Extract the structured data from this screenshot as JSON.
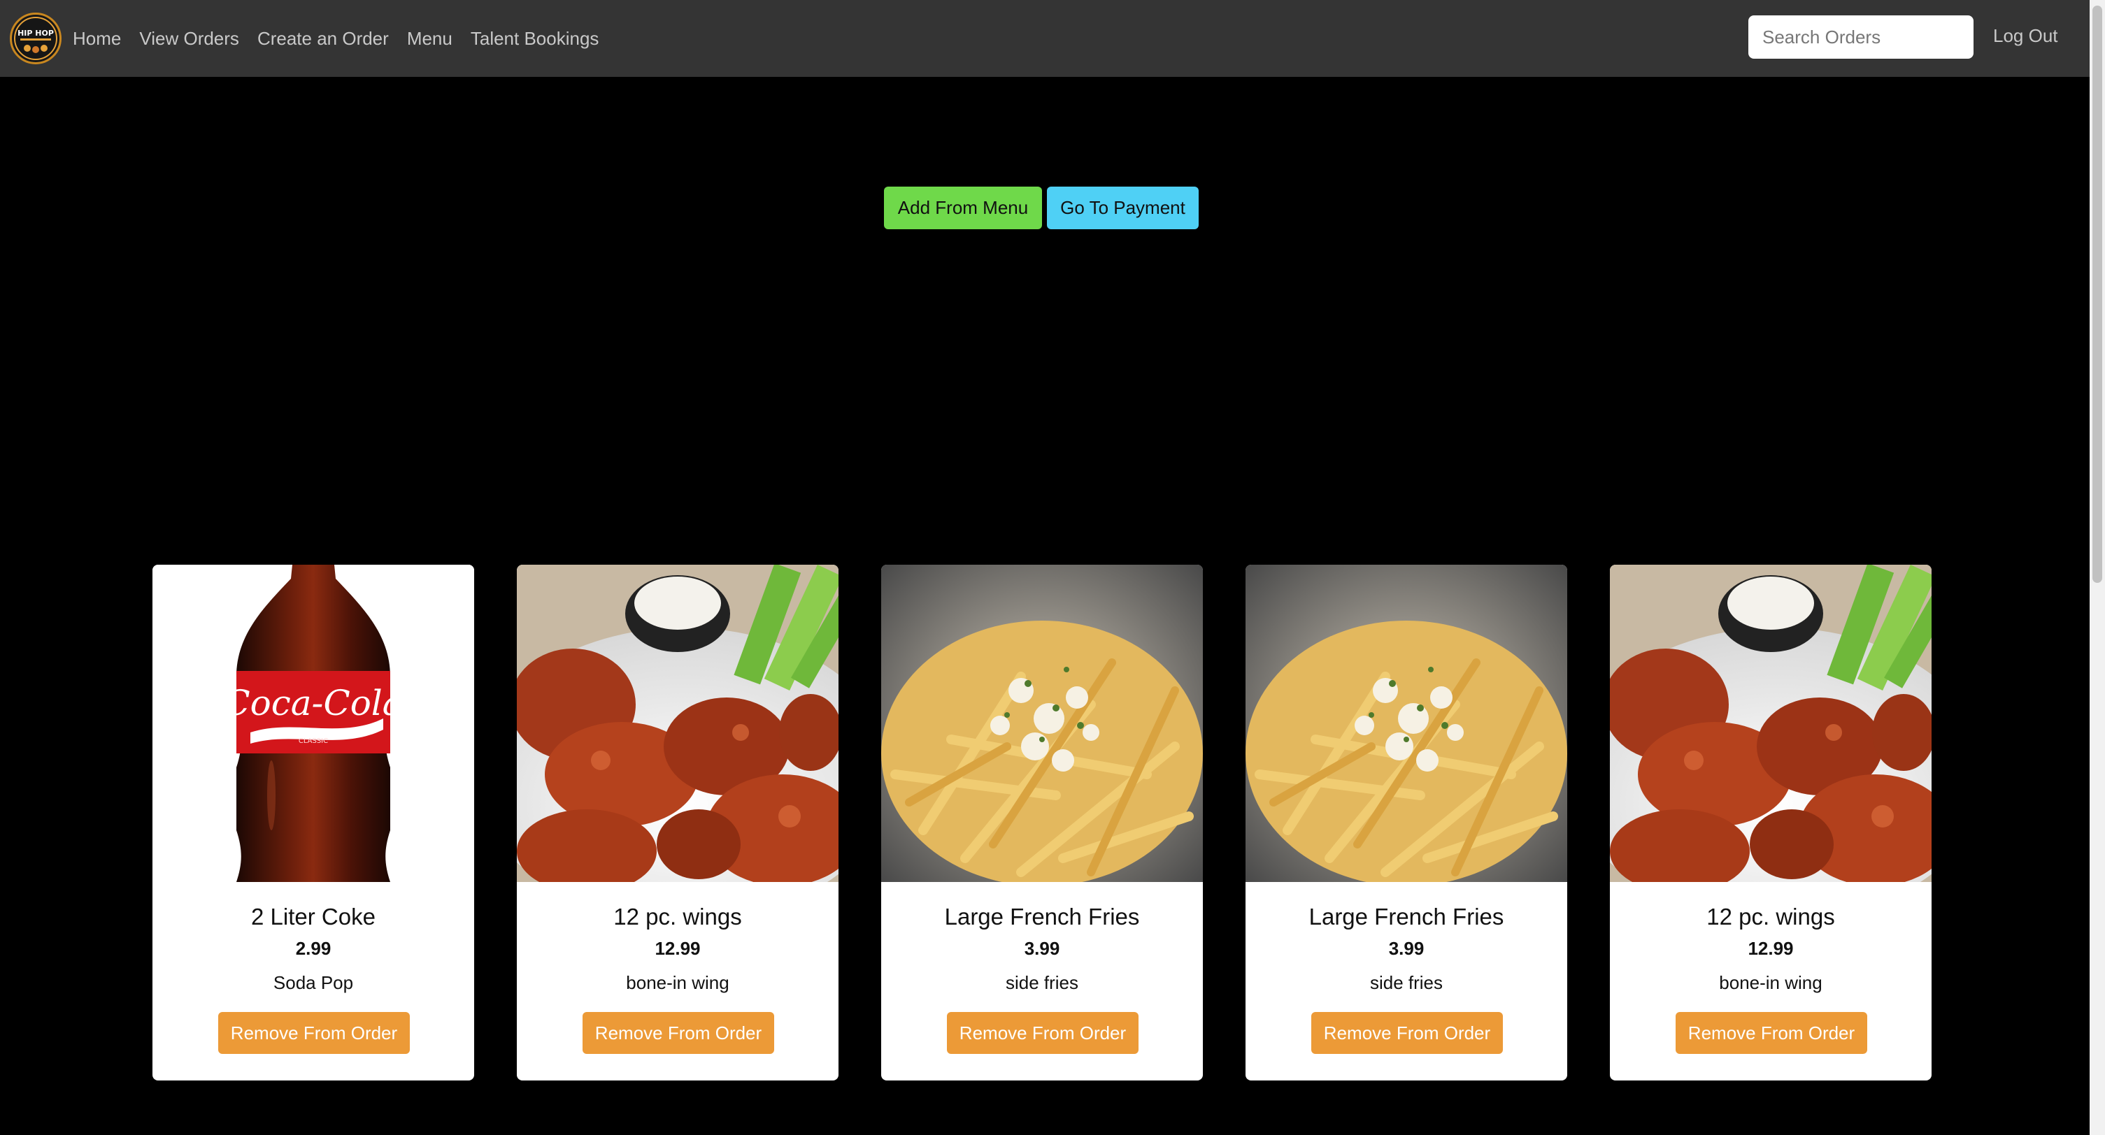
{
  "nav": {
    "logo_text": "HIP HOP",
    "links": [
      "Home",
      "View Orders",
      "Create an Order",
      "Menu",
      "Talent Bookings"
    ],
    "search_placeholder": "Search Orders",
    "logout_label": "Log Out"
  },
  "actions": {
    "add_label": "Add From Menu",
    "payment_label": "Go To Payment"
  },
  "colors": {
    "navbar": "#343434",
    "add_button": "#6fd94a",
    "payment_button": "#4fd0f5",
    "remove_button": "#ec9a37"
  },
  "order_items": [
    {
      "name": "2 Liter Coke",
      "price": "2.99",
      "description": "Soda Pop",
      "remove_label": "Remove From Order",
      "image": "coke-bottle"
    },
    {
      "name": "12 pc. wings",
      "price": "12.99",
      "description": "bone-in wing",
      "remove_label": "Remove From Order",
      "image": "wings"
    },
    {
      "name": "Large French Fries",
      "price": "3.99",
      "description": "side fries",
      "remove_label": "Remove From Order",
      "image": "fries"
    },
    {
      "name": "Large French Fries",
      "price": "3.99",
      "description": "side fries",
      "remove_label": "Remove From Order",
      "image": "fries"
    },
    {
      "name": "12 pc. wings",
      "price": "12.99",
      "description": "bone-in wing",
      "remove_label": "Remove From Order",
      "image": "wings"
    }
  ]
}
